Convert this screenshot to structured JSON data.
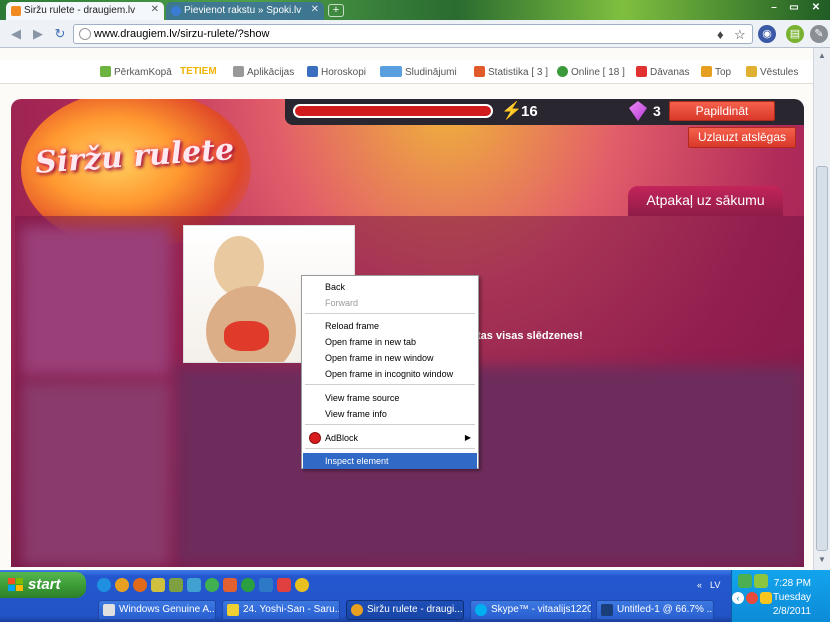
{
  "browser": {
    "tabs": [
      {
        "title": "Siržu rulete - draugiem.lv",
        "active": true
      },
      {
        "title": "Pievienot rakstu » Spoki.lv",
        "active": false
      }
    ],
    "new_tab_label": "+",
    "url": "www.draugiem.lv/sirzu-rulete/?show",
    "window_controls": [
      "minimize",
      "maximize",
      "close"
    ]
  },
  "site_nav": [
    {
      "label": "PērkamKopā",
      "icon": "perkamkopa-icon"
    },
    {
      "label": "TETIEM",
      "icon": "tetiem-icon"
    },
    {
      "label": "Aplikācijas",
      "icon": "apps-icon"
    },
    {
      "label": "Horoskopi",
      "icon": "horoscope-icon"
    },
    {
      "label": "Sludinājumi",
      "icon": "ads-icon"
    },
    {
      "label": "Statistika [ 3 ]",
      "icon": "stats-icon"
    },
    {
      "label": "Online [ 18 ]",
      "icon": "online-icon"
    },
    {
      "label": "Dāvanas",
      "icon": "gift-icon"
    },
    {
      "label": "Top",
      "icon": "top-icon"
    },
    {
      "label": "Vēstules",
      "icon": "mail-icon"
    }
  ],
  "game": {
    "logo": "Siržu rulete",
    "health_fraction": 1.0,
    "energy": "16",
    "gems": "3",
    "topup_label": "Papildināt",
    "unlock_label": "Uzlauzt atslēgas",
    "back_label": "Atpakaļ uz sākumu",
    "message": "tas visas slēdzenes!",
    "colors": {
      "accent": "#e23b2c",
      "panel": "#8f1c48",
      "hp": "#d01c1c"
    }
  },
  "context_menu": {
    "items": [
      {
        "label": "Back",
        "disabled": false
      },
      {
        "label": "Forward",
        "disabled": true
      },
      {
        "label": "Reload frame",
        "disabled": false
      },
      {
        "label": "Open frame in new tab",
        "disabled": false
      },
      {
        "label": "Open frame in new window",
        "disabled": false
      },
      {
        "label": "Open frame in incognito window",
        "disabled": false
      },
      {
        "label": "View frame source",
        "disabled": false
      },
      {
        "label": "View frame info",
        "disabled": false
      },
      {
        "label": "AdBlock",
        "disabled": false
      },
      {
        "label": "Inspect element",
        "disabled": false,
        "selected": true
      }
    ]
  },
  "taskbar": {
    "start_label": "start",
    "tasks": [
      {
        "label": "Windows Genuine A...",
        "active": false
      },
      {
        "label": "24. Yoshi-San - Saru...",
        "active": false
      },
      {
        "label": "Siržu rulete - draugi...",
        "active": true
      },
      {
        "label": "Skype™ - vitaalijs1220",
        "active": false
      },
      {
        "label": "Untitled-1 @ 66.7% ...",
        "active": false
      }
    ],
    "language": "LV",
    "clock": {
      "time": "7:28 PM",
      "day": "Tuesday",
      "date": "2/8/2011"
    }
  }
}
